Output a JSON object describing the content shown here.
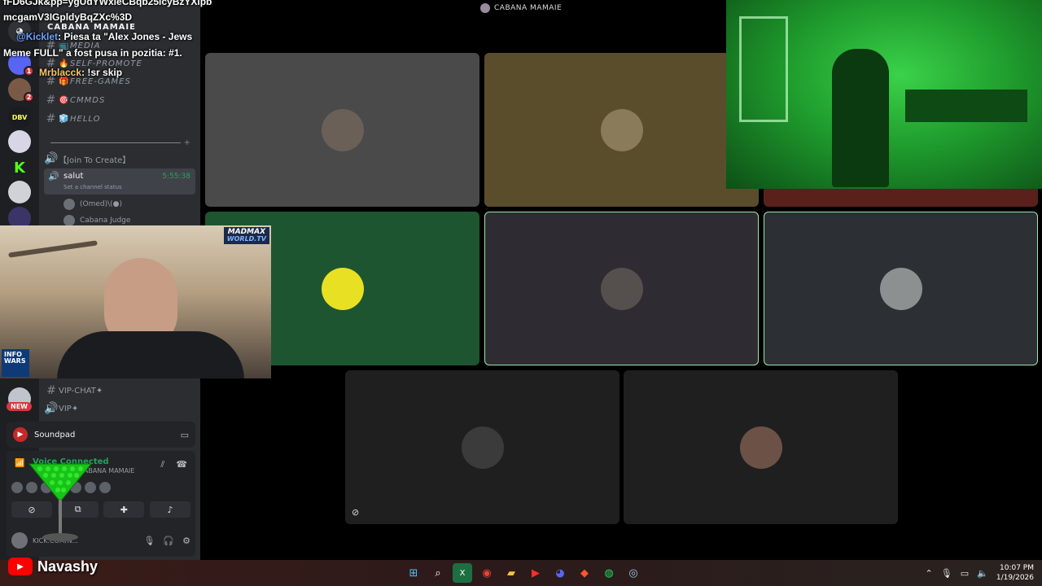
{
  "stream_overlay": {
    "chat_line_1": "fFD6GJk&pp=ygUdYWxleCBqb25lcyBzYXlpb",
    "chat_line_2": "mcgamV3IGpldyBqZXc%3D",
    "message_1_user": "@Kicklet",
    "message_1_text": ": Piesa ta \"Alex Jones - Jews",
    "message_1_cont": "Meme FULL\" a fost pusa in pozitia: #1.",
    "message_2_user": "Mrblacck",
    "message_2_text": ": !sr skip",
    "webcam_brand": "MADMAX",
    "webcam_brand_sub": "WORLD.TV",
    "webcam_corner": "INFO WARS",
    "youtube_channel": "Navashy"
  },
  "server_rail": {
    "badges": [
      "1",
      "2"
    ],
    "new_label": "NEW"
  },
  "sidebar": {
    "server_name": "CABANA MAMAIE",
    "channels": [
      {
        "emoji": "📺",
        "label": "MEDIA"
      },
      {
        "emoji": "🔥",
        "label": "SELF-PROMOTE"
      },
      {
        "emoji": "🎁",
        "label": "FREE-GAMES"
      },
      {
        "emoji": "🎯",
        "label": "CMMDS"
      },
      {
        "emoji": "🧊",
        "label": "HELLO"
      }
    ],
    "join_to_create": "【Join To Create】",
    "active_voice": {
      "name": "salut",
      "time": "5:55:38",
      "status": "Set a channel status"
    },
    "voice_members": [
      "(Omed)\\(●)",
      "Cabana Judge"
    ],
    "lower_channels": [
      "VIP-CHAT✦",
      "VIP✦"
    ]
  },
  "soundpad": {
    "title": "Soundpad"
  },
  "voice_panel": {
    "status": "Voice Connected",
    "channel": "salut / CABANA MAMAIE",
    "user_label": "KICK.COM/N..."
  },
  "stage": {
    "title": "CABANA MAMAIE",
    "tiles": [
      {
        "bg": "#4a4a4a",
        "avatar": "#6b6058",
        "speaking": false
      },
      {
        "bg": "#5a4d2c",
        "avatar": "#8a7b5a",
        "speaking": false
      },
      {
        "bg": "#1d5530",
        "avatar": "#e8e023",
        "speaking": false
      },
      {
        "bg": "#2e2b32",
        "avatar": "#55504e",
        "speaking": true
      },
      {
        "bg": "#2c2f33",
        "avatar": "#8d9090",
        "speaking": true
      },
      {
        "bg": "#1f1f1f",
        "avatar": "#3b3b3b",
        "speaking": false
      },
      {
        "bg": "#1f1f1f",
        "avatar": "#6c5147",
        "speaking": false
      }
    ]
  },
  "taskbar": {
    "time": "10:07 PM",
    "date": "1/19/2026",
    "apps": [
      "windows-icon",
      "search-icon",
      "excel-icon",
      "chrome-icon",
      "folder-icon",
      "youtube-music-icon",
      "discord-icon",
      "brave-icon",
      "spotify-icon",
      "steam-icon"
    ]
  },
  "colors": {
    "discord_bg": "#2b2d31",
    "rail_bg": "#1e1f22",
    "voice_green": "#23a559",
    "accent_red": "#da373c"
  }
}
